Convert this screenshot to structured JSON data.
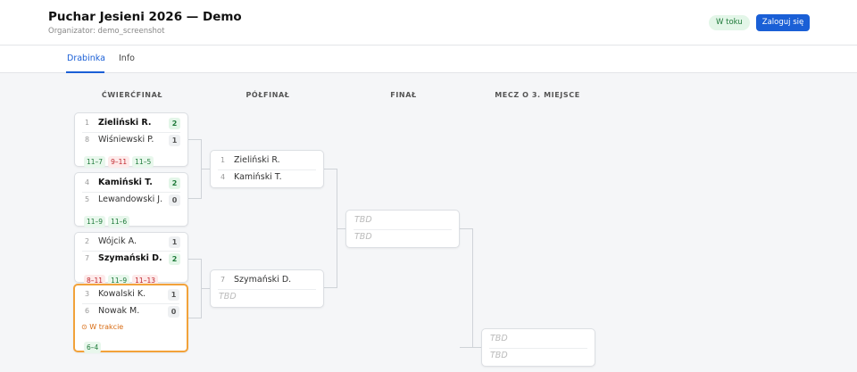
{
  "header": {
    "title": "Puchar Jesieni 2026 — Demo",
    "subtitle": "Organizator: demo_screenshot",
    "status": "W toku",
    "login": "Zaloguj się"
  },
  "tabs": [
    {
      "label": "Drabinka",
      "active": true
    },
    {
      "label": "Info",
      "active": false
    }
  ],
  "rounds": [
    "ĆWIERĆFINAŁ",
    "PÓŁFINAŁ",
    "FINAŁ",
    "MECZ O 3. MIEJSCE"
  ],
  "quarterfinals": [
    {
      "p1": {
        "seed": "1",
        "name": "Zieliński R.",
        "wins": "2",
        "winner": true
      },
      "p2": {
        "seed": "8",
        "name": "Wiśniewski P.",
        "wins": "1",
        "winner": false
      },
      "sets": [
        {
          "score": "11–7",
          "result": "win"
        },
        {
          "score": "9–11",
          "result": "loss"
        },
        {
          "score": "11–5",
          "result": "win"
        }
      ]
    },
    {
      "p1": {
        "seed": "4",
        "name": "Kamiński T.",
        "wins": "2",
        "winner": true
      },
      "p2": {
        "seed": "5",
        "name": "Lewandowski J.",
        "wins": "0",
        "winner": false
      },
      "sets": [
        {
          "score": "11–9",
          "result": "win"
        },
        {
          "score": "11–6",
          "result": "win"
        }
      ]
    },
    {
      "p1": {
        "seed": "2",
        "name": "Wójcik A.",
        "wins": "1",
        "winner": false
      },
      "p2": {
        "seed": "7",
        "name": "Szymański D.",
        "wins": "2",
        "winner": true
      },
      "sets": [
        {
          "score": "8–11",
          "result": "loss"
        },
        {
          "score": "11–9",
          "result": "win"
        },
        {
          "score": "11–13",
          "result": "loss"
        }
      ]
    },
    {
      "p1": {
        "seed": "3",
        "name": "Kowalski K.",
        "wins": "1",
        "winner": false
      },
      "p2": {
        "seed": "6",
        "name": "Nowak M.",
        "wins": "0",
        "winner": false
      },
      "live": "W trakcie",
      "sets": [
        {
          "score": "6–4",
          "result": "win"
        }
      ]
    }
  ],
  "semifinals": [
    {
      "p1": {
        "seed": "1",
        "name": "Zieliński R."
      },
      "p2": {
        "seed": "4",
        "name": "Kamiński T."
      }
    },
    {
      "p1": {
        "seed": "7",
        "name": "Szymański D."
      },
      "p2": {
        "tbd": "TBD"
      }
    }
  ],
  "final": {
    "p1": "TBD",
    "p2": "TBD"
  },
  "third_place": {
    "p1": "TBD",
    "p2": "TBD"
  },
  "colors": {
    "accent": "#1a5fd6",
    "win": "#1f7a3a",
    "loss": "#c0262d",
    "live": "#f2a23a"
  }
}
